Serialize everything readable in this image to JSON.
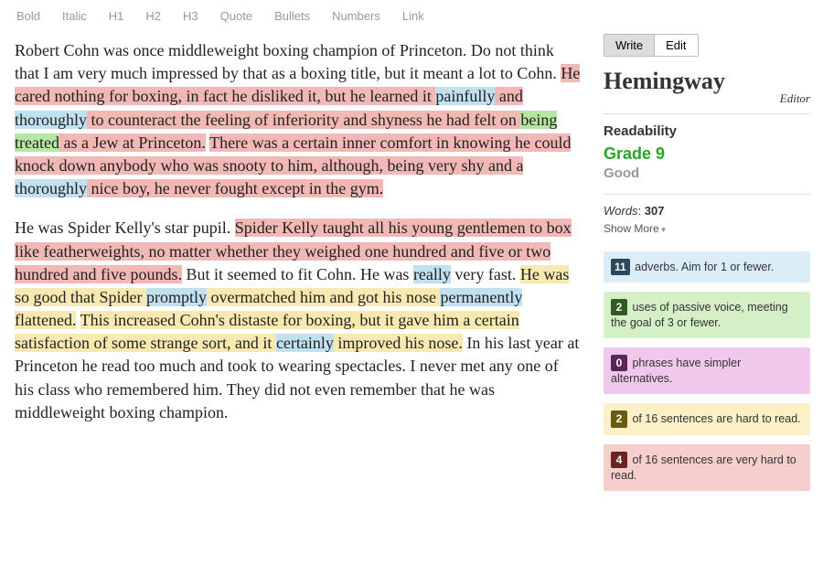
{
  "toolbar": {
    "bold": "Bold",
    "italic": "Italic",
    "h1": "H1",
    "h2": "H2",
    "h3": "H3",
    "quote": "Quote",
    "bullets": "Bullets",
    "numbers": "Numbers",
    "link": "Link"
  },
  "mode": {
    "write": "Write",
    "edit": "Edit"
  },
  "logo": {
    "main": "Hemingway",
    "sub": "Editor"
  },
  "readability": {
    "label": "Readability",
    "grade": "Grade 9",
    "desc": "Good",
    "words_label": "Words",
    "words_value": "307",
    "show_more": "Show More"
  },
  "stats": {
    "adverb": {
      "num": "11",
      "text": " adverbs. Aim for 1 or fewer."
    },
    "passive": {
      "num": "2",
      "text": " uses of passive voice, meeting the goal of 3 or fewer."
    },
    "complex": {
      "num": "0",
      "text": " phrases have simpler alternatives."
    },
    "hard": {
      "num": "2",
      "text": " of 16 sentences are hard to read."
    },
    "vhard": {
      "num": "4",
      "text": " of 16 sentences are very hard to read."
    }
  },
  "text": {
    "p1a": "Robert Cohn was once middleweight boxing champion of Princeton. Do not think that I am very much impressed by that as a boxing title, but it meant a lot to Cohn. ",
    "p1b": "He cared nothing for boxing, in fact he disliked it, but he learned it ",
    "p1c": "painfully",
    "p1d": " and ",
    "p1e": "thoroughly",
    "p1f": " to counteract the feeling of inferiority and shyness he had felt on ",
    "p1g": "being treated",
    "p1h": " as a Jew at Princeton.",
    "p1i": " ",
    "p1j": "There was a certain inner comfort in knowing he could knock down anybody who was snooty to him, although, being very shy and a ",
    "p1k": "thoroughly",
    "p1l": " nice boy, he never fought except in the gym.",
    "p2a": "He was Spider Kelly's star pupil. ",
    "p2b": "Spider Kelly taught all his young gentlemen to box like featherweights, no matter whether they weighed one hundred and five or two hundred and five pounds.",
    "p2c": " But it seemed to fit Cohn. He was ",
    "p2d": "really",
    "p2e": " very fast. ",
    "p2f": "He was so good that Spider ",
    "p2g": "promptly",
    "p2h": " overmatched him and got his nose ",
    "p2i": "permanently",
    "p2j": " flattened.",
    "p2k": " ",
    "p2l": "This increased Cohn's distaste for boxing, but it gave him a certain satisfaction of some strange sort, and it ",
    "p2m": "certainly",
    "p2n": " improved his nose.",
    "p2o": " In his last year at Princeton he read too much and took to wearing spectacles. I never met any one of his class who remembered him. They did not even remember that he was middleweight boxing champion."
  }
}
